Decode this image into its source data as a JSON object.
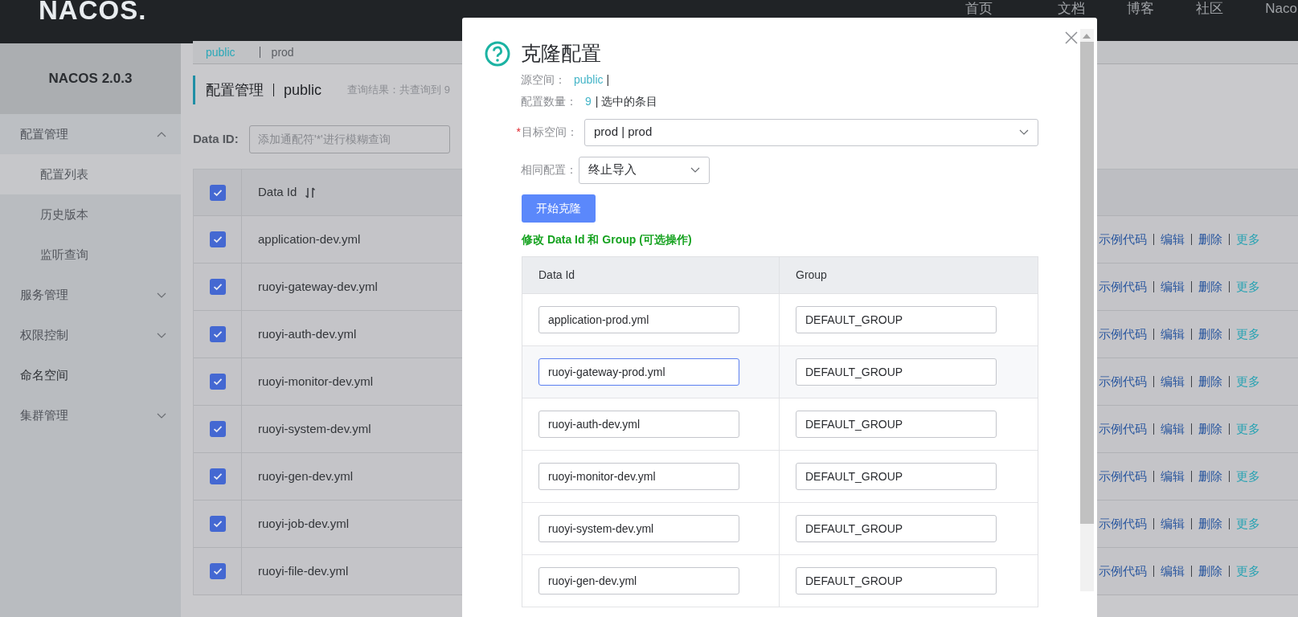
{
  "header": {
    "logo": "NACOS.",
    "nav": [
      "首页",
      "文档",
      "博客",
      "社区",
      "Naco"
    ]
  },
  "sidebar": {
    "title": "NACOS 2.0.3",
    "items": [
      {
        "label": "配置管理",
        "expanded": true,
        "children": [
          {
            "label": "配置列表",
            "selected": true
          },
          {
            "label": "历史版本",
            "selected": false
          },
          {
            "label": "监听查询",
            "selected": false
          }
        ]
      },
      {
        "label": "服务管理",
        "expanded": false
      },
      {
        "label": "权限控制",
        "expanded": false
      },
      {
        "label": "命名空间"
      },
      {
        "label": "集群管理",
        "expanded": false
      }
    ]
  },
  "namespaces": [
    {
      "label": "public",
      "selected": true
    },
    {
      "label": "prod",
      "selected": false
    }
  ],
  "page_title": {
    "title": "配置管理",
    "namespace": "public",
    "result": "查询结果：共查询到 9"
  },
  "search": {
    "label": "Data ID:",
    "placeholder": "添加通配符'*'进行模糊查询"
  },
  "table": {
    "all_checked": true,
    "columns": [
      "Data Id"
    ],
    "rows": [
      {
        "data_id": "application-dev.yml",
        "checked": true,
        "actions": [
          "示例代码",
          "编辑",
          "删除"
        ],
        "more": "更多"
      },
      {
        "data_id": "ruoyi-gateway-dev.yml",
        "checked": true,
        "actions": [
          "示例代码",
          "编辑",
          "删除"
        ],
        "more": "更多"
      },
      {
        "data_id": "ruoyi-auth-dev.yml",
        "checked": true,
        "actions": [
          "示例代码",
          "编辑",
          "删除"
        ],
        "more": "更多"
      },
      {
        "data_id": "ruoyi-monitor-dev.yml",
        "checked": true,
        "actions": [
          "示例代码",
          "编辑",
          "删除"
        ],
        "more": "更多"
      },
      {
        "data_id": "ruoyi-system-dev.yml",
        "checked": true,
        "actions": [
          "示例代码",
          "编辑",
          "删除"
        ],
        "more": "更多"
      },
      {
        "data_id": "ruoyi-gen-dev.yml",
        "checked": true,
        "actions": [
          "示例代码",
          "编辑",
          "删除"
        ],
        "more": "更多"
      },
      {
        "data_id": "ruoyi-job-dev.yml",
        "checked": true,
        "actions": [
          "示例代码",
          "编辑",
          "删除"
        ],
        "more": "更多"
      },
      {
        "data_id": "ruoyi-file-dev.yml",
        "checked": true,
        "actions": [
          "示例代码",
          "编辑",
          "删除"
        ],
        "more": "更多"
      }
    ]
  },
  "dialog": {
    "title": "克隆配置",
    "source_label": "源空间：",
    "source_value": "public",
    "source_separator": "|",
    "count_label": "配置数量：",
    "count_value": "9",
    "count_note": "| 选中的条目",
    "target": {
      "label": "目标空间：",
      "required_mark": "*",
      "value": "prod | prod"
    },
    "policy": {
      "label": "相同配置：",
      "value": "终止导入"
    },
    "button": "开始克隆",
    "note": "修改 Data Id 和 Group (可选操作)",
    "columns": [
      "Data Id",
      "Group"
    ],
    "rows": [
      {
        "data_id": "application-prod.yml",
        "group": "DEFAULT_GROUP",
        "focused": false
      },
      {
        "data_id": "ruoyi-gateway-prod.yml",
        "group": "DEFAULT_GROUP",
        "focused": true
      },
      {
        "data_id": "ruoyi-auth-dev.yml",
        "group": "DEFAULT_GROUP",
        "focused": false
      },
      {
        "data_id": "ruoyi-monitor-dev.yml",
        "group": "DEFAULT_GROUP",
        "focused": false
      },
      {
        "data_id": "ruoyi-system-dev.yml",
        "group": "DEFAULT_GROUP",
        "focused": false
      },
      {
        "data_id": "ruoyi-gen-dev.yml",
        "group": "DEFAULT_GROUP",
        "focused": false
      }
    ]
  }
}
